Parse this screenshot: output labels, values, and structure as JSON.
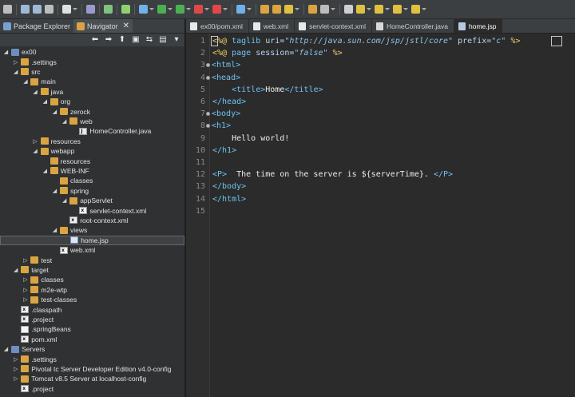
{
  "left_tabs": [
    {
      "label": "Package Explorer",
      "active": false
    },
    {
      "label": "Navigator",
      "active": true
    }
  ],
  "editor_tabs": [
    {
      "label": "ex00/pom.xml",
      "icon": "xml-file-icon",
      "active": false
    },
    {
      "label": "web.xml",
      "icon": "xml-file-icon",
      "active": false
    },
    {
      "label": "servlet-context.xml",
      "icon": "xml-file-icon",
      "active": false
    },
    {
      "label": "HomeController.java",
      "icon": "java-file-icon",
      "active": false
    },
    {
      "label": "home.jsp",
      "icon": "jsp-file-icon",
      "active": true
    }
  ],
  "tree": [
    {
      "label": "ex00",
      "depth": 0,
      "twisty": "open",
      "icon": "project-icon"
    },
    {
      "label": ".settings",
      "depth": 1,
      "twisty": "closed",
      "icon": "folder-icon"
    },
    {
      "label": "src",
      "depth": 1,
      "twisty": "open",
      "icon": "folder-icon"
    },
    {
      "label": "main",
      "depth": 2,
      "twisty": "open",
      "icon": "folder-icon"
    },
    {
      "label": "java",
      "depth": 3,
      "twisty": "open",
      "icon": "folder-icon"
    },
    {
      "label": "org",
      "depth": 4,
      "twisty": "open",
      "icon": "folder-icon"
    },
    {
      "label": "zerock",
      "depth": 5,
      "twisty": "open",
      "icon": "folder-icon"
    },
    {
      "label": "web",
      "depth": 6,
      "twisty": "open",
      "icon": "folder-icon"
    },
    {
      "label": "HomeController.java",
      "depth": 7,
      "twisty": "none",
      "icon": "java-file-icon"
    },
    {
      "label": "resources",
      "depth": 3,
      "twisty": "closed",
      "icon": "folder-icon"
    },
    {
      "label": "webapp",
      "depth": 3,
      "twisty": "open",
      "icon": "folder-icon"
    },
    {
      "label": "resources",
      "depth": 4,
      "twisty": "none",
      "icon": "folder-icon"
    },
    {
      "label": "WEB-INF",
      "depth": 4,
      "twisty": "open",
      "icon": "folder-icon"
    },
    {
      "label": "classes",
      "depth": 5,
      "twisty": "none",
      "icon": "folder-icon"
    },
    {
      "label": "spring",
      "depth": 5,
      "twisty": "open",
      "icon": "folder-icon"
    },
    {
      "label": "appServlet",
      "depth": 6,
      "twisty": "open",
      "icon": "folder-icon"
    },
    {
      "label": "servlet-context.xml",
      "depth": 7,
      "twisty": "none",
      "icon": "xml-file-icon"
    },
    {
      "label": "root-context.xml",
      "depth": 6,
      "twisty": "none",
      "icon": "xml-file-icon"
    },
    {
      "label": "views",
      "depth": 5,
      "twisty": "open",
      "icon": "folder-icon"
    },
    {
      "label": "home.jsp",
      "depth": 6,
      "twisty": "none",
      "icon": "jsp-file-icon",
      "selected": true
    },
    {
      "label": "web.xml",
      "depth": 5,
      "twisty": "none",
      "icon": "xml-file-icon"
    },
    {
      "label": "test",
      "depth": 2,
      "twisty": "closed",
      "icon": "folder-icon"
    },
    {
      "label": "target",
      "depth": 1,
      "twisty": "open",
      "icon": "folder-icon"
    },
    {
      "label": "classes",
      "depth": 2,
      "twisty": "closed",
      "icon": "folder-icon"
    },
    {
      "label": "m2e-wtp",
      "depth": 2,
      "twisty": "closed",
      "icon": "folder-icon"
    },
    {
      "label": "test-classes",
      "depth": 2,
      "twisty": "closed",
      "icon": "folder-icon"
    },
    {
      "label": ".classpath",
      "depth": 1,
      "twisty": "none",
      "icon": "xml-file-icon"
    },
    {
      "label": ".project",
      "depth": 1,
      "twisty": "none",
      "icon": "xml-file-icon"
    },
    {
      "label": ".springBeans",
      "depth": 1,
      "twisty": "none",
      "icon": "plain-file-icon"
    },
    {
      "label": "pom.xml",
      "depth": 1,
      "twisty": "none",
      "icon": "xml-file-icon"
    },
    {
      "label": "Servers",
      "depth": 0,
      "twisty": "open",
      "icon": "project-icon"
    },
    {
      "label": ".settings",
      "depth": 1,
      "twisty": "closed",
      "icon": "folder-icon"
    },
    {
      "label": "Pivotal tc Server Developer Edition v4.0-config",
      "depth": 1,
      "twisty": "closed",
      "icon": "folder-icon"
    },
    {
      "label": "Tomcat v8.5 Server at localhost-config",
      "depth": 1,
      "twisty": "closed",
      "icon": "folder-icon"
    },
    {
      "label": ".project",
      "depth": 1,
      "twisty": "none",
      "icon": "xml-file-icon"
    }
  ],
  "editor": {
    "lines": [
      {
        "n": "1",
        "fold": false,
        "tokens": [
          [
            "dir",
            "<%@ "
          ],
          [
            "tag",
            "taglib"
          ],
          [
            "txt",
            " "
          ],
          [
            "attr",
            "uri="
          ],
          [
            "str",
            "\"http://java.sun.com/jsp/jstl/core\""
          ],
          [
            "txt",
            " "
          ],
          [
            "attr",
            "prefix="
          ],
          [
            "str",
            "\"c\""
          ],
          [
            "txt",
            " "
          ],
          [
            "dir",
            "%>"
          ]
        ]
      },
      {
        "n": "2",
        "fold": false,
        "tokens": [
          [
            "dir",
            "<%@ "
          ],
          [
            "tag",
            "page"
          ],
          [
            "txt",
            " "
          ],
          [
            "attr",
            "session="
          ],
          [
            "str",
            "\"false\""
          ],
          [
            "txt",
            " "
          ],
          [
            "dir",
            "%>"
          ]
        ]
      },
      {
        "n": "3",
        "fold": true,
        "tokens": [
          [
            "tag",
            "<html>"
          ]
        ]
      },
      {
        "n": "4",
        "fold": true,
        "tokens": [
          [
            "tag",
            "<head>"
          ]
        ]
      },
      {
        "n": "5",
        "fold": false,
        "tokens": [
          [
            "txt",
            "    "
          ],
          [
            "tag",
            "<title>"
          ],
          [
            "txt",
            "Home"
          ],
          [
            "tag",
            "</title>"
          ]
        ]
      },
      {
        "n": "6",
        "fold": false,
        "tokens": [
          [
            "tag",
            "</head>"
          ]
        ]
      },
      {
        "n": "7",
        "fold": true,
        "tokens": [
          [
            "tag",
            "<body>"
          ]
        ]
      },
      {
        "n": "8",
        "fold": true,
        "tokens": [
          [
            "tag",
            "<h1>"
          ]
        ]
      },
      {
        "n": "9",
        "fold": false,
        "tokens": [
          [
            "txt",
            "    Hello world!"
          ]
        ]
      },
      {
        "n": "10",
        "fold": false,
        "tokens": [
          [
            "tag",
            "</h1>"
          ]
        ]
      },
      {
        "n": "11",
        "fold": false,
        "tokens": []
      },
      {
        "n": "12",
        "fold": false,
        "tokens": [
          [
            "tag",
            "<P>"
          ],
          [
            "txt",
            "  The time on the server is ${serverTime}. "
          ],
          [
            "tag",
            "</P>"
          ]
        ]
      },
      {
        "n": "13",
        "fold": false,
        "tokens": [
          [
            "tag",
            "</body>"
          ]
        ]
      },
      {
        "n": "14",
        "fold": false,
        "tokens": [
          [
            "tag",
            "</html>"
          ]
        ]
      },
      {
        "n": "15",
        "fold": false,
        "tokens": []
      }
    ]
  },
  "colors": {
    "tag": "#6ec3f2",
    "directive": "#f2d36b",
    "string": "#8dc2e8",
    "folder": "#d9a441"
  }
}
